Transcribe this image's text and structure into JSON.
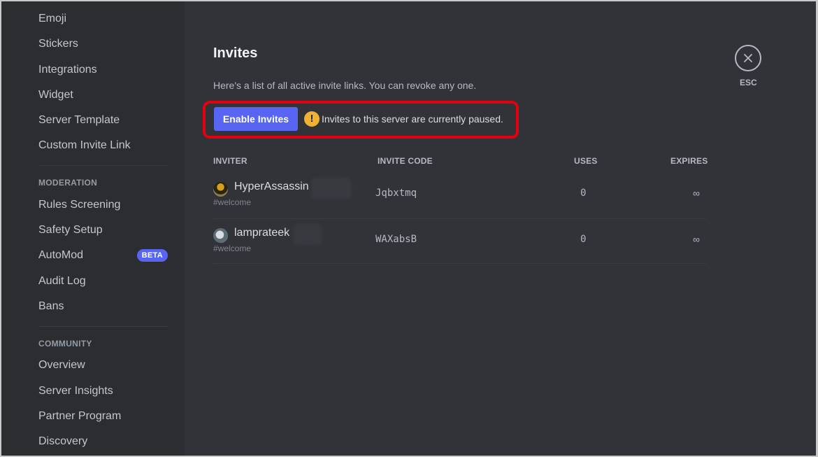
{
  "sidebar": {
    "items_top": [
      {
        "label": "Emoji"
      },
      {
        "label": "Stickers"
      },
      {
        "label": "Integrations"
      },
      {
        "label": "Widget"
      },
      {
        "label": "Server Template"
      },
      {
        "label": "Custom Invite Link"
      }
    ],
    "moderation": {
      "header": "MODERATION",
      "items": [
        {
          "label": "Rules Screening"
        },
        {
          "label": "Safety Setup"
        },
        {
          "label": "AutoMod",
          "badge": "BETA"
        },
        {
          "label": "Audit Log"
        },
        {
          "label": "Bans"
        }
      ]
    },
    "community": {
      "header": "COMMUNITY",
      "items": [
        {
          "label": "Overview"
        },
        {
          "label": "Server Insights"
        },
        {
          "label": "Partner Program"
        },
        {
          "label": "Discovery"
        }
      ]
    }
  },
  "main": {
    "title": "Invites",
    "description": "Here's a list of all active invite links. You can revoke any one.",
    "enable_button": "Enable Invites",
    "warning_icon": "!",
    "warning_text": "Invites to this server are currently paused.",
    "columns": [
      "INVITER",
      "INVITE CODE",
      "USES",
      "EXPIRES"
    ],
    "invites": [
      {
        "inviter": "HyperAssassin",
        "channel": "#welcome",
        "code": "Jqbxtmq",
        "uses": "0",
        "expires": "∞"
      },
      {
        "inviter": "lamprateek",
        "channel": "#welcome",
        "code": "WAXabsB",
        "uses": "0",
        "expires": "∞"
      }
    ],
    "close_label": "ESC"
  },
  "colors": {
    "accent": "#5865f2",
    "warning": "#f0b232",
    "highlight": "#e3000f"
  }
}
